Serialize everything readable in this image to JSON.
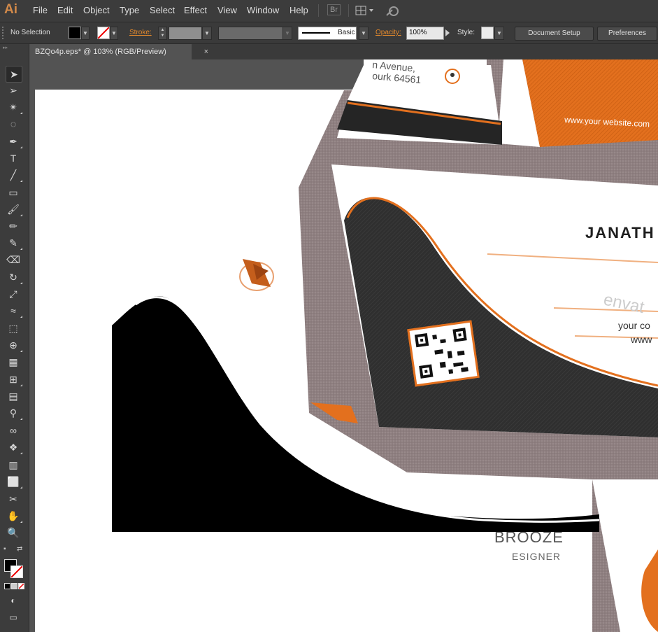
{
  "app": {
    "logo": "Ai"
  },
  "menu": [
    "File",
    "Edit",
    "Object",
    "Type",
    "Select",
    "Effect",
    "View",
    "Window",
    "Help"
  ],
  "menubar_icons": {
    "bridge": "Br",
    "arrange": "arrange-documents-icon",
    "sync": "gpu-sync-icon"
  },
  "control_bar": {
    "selection": "No Selection",
    "stroke_label": "Stroke:",
    "brush_label": "Basic",
    "opacity_label": "Opacity:",
    "opacity_value": "100%",
    "style_label": "Style:",
    "document_setup": "Document Setup",
    "preferences": "Preferences"
  },
  "document_tab": {
    "title": "BZQo4p.eps* @ 103% (RGB/Preview)",
    "close": "×"
  },
  "tools": [
    {
      "name": "selection-tool",
      "glyph": "➤"
    },
    {
      "name": "direct-selection-tool",
      "glyph": "➢"
    },
    {
      "name": "magic-wand-tool",
      "glyph": "✴"
    },
    {
      "name": "lasso-tool",
      "glyph": "◌"
    },
    {
      "name": "pen-tool",
      "glyph": "✒"
    },
    {
      "name": "type-tool",
      "glyph": "T"
    },
    {
      "name": "line-tool",
      "glyph": "╱"
    },
    {
      "name": "rectangle-tool",
      "glyph": "▭"
    },
    {
      "name": "paintbrush-tool",
      "glyph": "🖌"
    },
    {
      "name": "pencil-tool",
      "glyph": "✏"
    },
    {
      "name": "blob-brush-tool",
      "glyph": "✎"
    },
    {
      "name": "eraser-tool",
      "glyph": "⌫"
    },
    {
      "name": "rotate-tool",
      "glyph": "↻"
    },
    {
      "name": "scale-tool",
      "glyph": "⤢"
    },
    {
      "name": "warp-tool",
      "glyph": "≈"
    },
    {
      "name": "free-transform-tool",
      "glyph": "⬚"
    },
    {
      "name": "shape-builder-tool",
      "glyph": "⊕"
    },
    {
      "name": "perspective-grid-tool",
      "glyph": "▦"
    },
    {
      "name": "mesh-tool",
      "glyph": "⊞"
    },
    {
      "name": "gradient-tool",
      "glyph": "▤"
    },
    {
      "name": "eyedropper-tool",
      "glyph": "⚲"
    },
    {
      "name": "blend-tool",
      "glyph": "∞"
    },
    {
      "name": "symbol-sprayer-tool",
      "glyph": "❖"
    },
    {
      "name": "column-graph-tool",
      "glyph": "▥"
    },
    {
      "name": "artboard-tool",
      "glyph": "⬜"
    },
    {
      "name": "slice-tool",
      "glyph": "✂"
    },
    {
      "name": "hand-tool",
      "glyph": "✋"
    },
    {
      "name": "zoom-tool",
      "glyph": "🔍"
    }
  ],
  "tool_footer": {
    "default_colors": "▪",
    "swap": "⇄",
    "none": "⊘",
    "draw_mode": "◐",
    "screen_mode": "▭"
  },
  "card_text": {
    "address_line1": "n Avenue,",
    "address_line2": "ourk 64561",
    "website": "www.your website.com",
    "name": "JANATH",
    "your_co": "your co",
    "www": "www",
    "surname": "BROOZE",
    "title": "ESIGNER",
    "watermark": "envat"
  },
  "colors": {
    "accent": "#e3701e",
    "dark": "#2f2f2f",
    "frame": "#8e7f80"
  }
}
